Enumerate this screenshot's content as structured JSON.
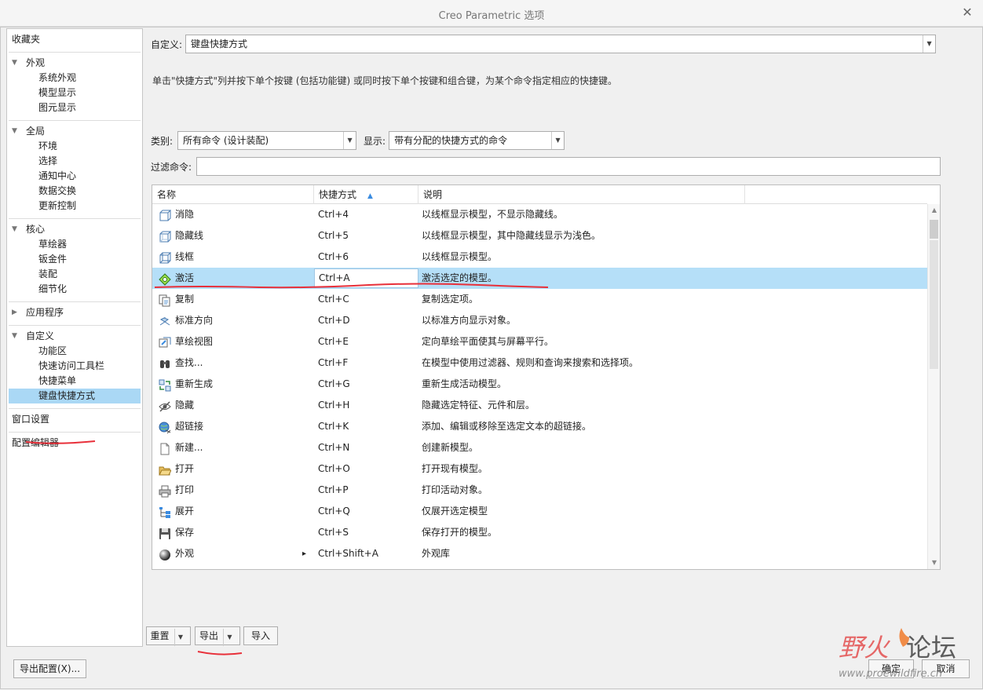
{
  "window": {
    "title": "Creo Parametric 选项"
  },
  "sidebar": {
    "groups": [
      {
        "header": "收藏夹",
        "items": []
      },
      {
        "header": "外观",
        "items": [
          "系统外观",
          "模型显示",
          "图元显示"
        ]
      },
      {
        "header": "全局",
        "items": [
          "环境",
          "选择",
          "通知中心",
          "数据交换",
          "更新控制"
        ]
      },
      {
        "header": "核心",
        "items": [
          "草绘器",
          "钣金件",
          "装配",
          "细节化"
        ]
      },
      {
        "header": "应用程序",
        "items": []
      },
      {
        "header": "自定义",
        "items": [
          "功能区",
          "快速访问工具栏",
          "快捷菜单",
          "键盘快捷方式"
        ]
      },
      {
        "header": "窗口设置",
        "items": []
      },
      {
        "header": "配置编辑器",
        "items": []
      }
    ],
    "selected": "键盘快捷方式"
  },
  "main": {
    "customize_label": "自定义:",
    "customize_value": "键盘快捷方式",
    "description": "单击\"快捷方式\"列并按下单个按键 (包括功能键) 或同时按下单个按键和组合键，为某个命令指定相应的快捷键。",
    "category_label": "类别:",
    "category_value": "所有命令 (设计装配)",
    "display_label": "显示:",
    "display_value": "带有分配的快捷方式的命令",
    "filter_label": "过滤命令:",
    "filter_value": "",
    "columns": [
      "名称",
      "快捷方式",
      "说明"
    ],
    "sort_icon": "sort-ascending-icon",
    "rows": [
      {
        "name": "消隐",
        "shortcut": "Ctrl+4",
        "desc": "以线框显示模型，不显示隐藏线。",
        "icon": "no-hidden-icon"
      },
      {
        "name": "隐藏线",
        "shortcut": "Ctrl+5",
        "desc": "以线框显示模型，其中隐藏线显示为浅色。",
        "icon": "hidden-line-icon"
      },
      {
        "name": "线框",
        "shortcut": "Ctrl+6",
        "desc": "以线框显示模型。",
        "icon": "wireframe-icon"
      },
      {
        "name": "激活",
        "shortcut": "Ctrl+A",
        "desc": "激活选定的模型。",
        "icon": "activate-icon"
      },
      {
        "name": "复制",
        "shortcut": "Ctrl+C",
        "desc": "复制选定项。",
        "icon": "copy-icon"
      },
      {
        "name": "标准方向",
        "shortcut": "Ctrl+D",
        "desc": "以标准方向显示对象。",
        "icon": "standard-orientation-icon"
      },
      {
        "name": "草绘视图",
        "shortcut": "Ctrl+E",
        "desc": "定向草绘平面使其与屏幕平行。",
        "icon": "sketch-view-icon"
      },
      {
        "name": "查找...",
        "shortcut": "Ctrl+F",
        "desc": "在模型中使用过滤器、规则和查询来搜索和选择项。",
        "icon": "binoculars-icon"
      },
      {
        "name": "重新生成",
        "shortcut": "Ctrl+G",
        "desc": "重新生成活动模型。",
        "icon": "regenerate-icon"
      },
      {
        "name": "隐藏",
        "shortcut": "Ctrl+H",
        "desc": "隐藏选定特征、元件和层。",
        "icon": "hide-eye-icon"
      },
      {
        "name": "超链接",
        "shortcut": "Ctrl+K",
        "desc": "添加、编辑或移除至选定文本的超链接。",
        "icon": "hyperlink-globe-icon"
      },
      {
        "name": "新建...",
        "shortcut": "Ctrl+N",
        "desc": "创建新模型。",
        "icon": "new-file-icon"
      },
      {
        "name": "打开",
        "shortcut": "Ctrl+O",
        "desc": "打开现有模型。",
        "icon": "open-folder-icon"
      },
      {
        "name": "打印",
        "shortcut": "Ctrl+P",
        "desc": "打印活动对象。",
        "icon": "print-icon"
      },
      {
        "name": "展开",
        "shortcut": "Ctrl+Q",
        "desc": "仅展开选定模型",
        "icon": "expand-icon"
      },
      {
        "name": "保存",
        "shortcut": "Ctrl+S",
        "desc": "保存打开的模型。",
        "icon": "save-icon"
      },
      {
        "name": "外观",
        "shortcut": "Ctrl+Shift+A",
        "desc": "外观库",
        "icon": "appearance-sphere-icon"
      }
    ],
    "selected_row": 3
  },
  "buttons": {
    "reset": "重置",
    "export": "导出",
    "import": "导入",
    "export_config": "导出配置(X)...",
    "ok": "确定",
    "cancel": "取消"
  },
  "watermark": {
    "text": "野火论坛",
    "url": "www.proewildfire.cn"
  },
  "colors": {
    "selection": "#b5dff8",
    "sidebar_selection": "#aad8f5",
    "annotation_red": "#e8303a"
  }
}
